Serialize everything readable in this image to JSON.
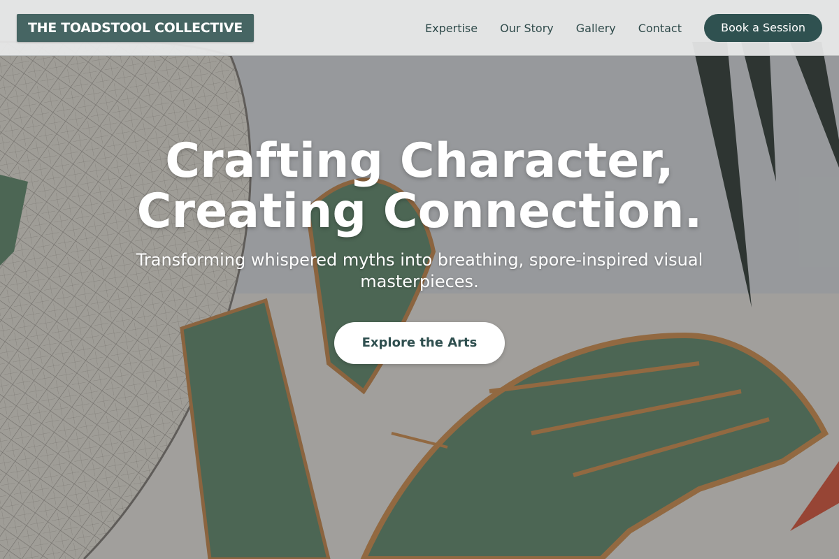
{
  "header": {
    "logo_text": "THE TOADSTOOL COLLECTIVE",
    "nav": [
      {
        "label": "Expertise"
      },
      {
        "label": "Our Story"
      },
      {
        "label": "Gallery"
      },
      {
        "label": "Contact"
      }
    ],
    "cta_label": "Book a Session"
  },
  "hero": {
    "title": "Crafting Character, Creating Connection.",
    "subtitle": "Transforming whispered myths into breathing, spore-inspired visual masterpieces.",
    "button_label": "Explore the Arts",
    "background_image": "illustration-background"
  },
  "colors": {
    "brand": "#466563",
    "cta": "#2f5150",
    "header_bg": "#e8eaea",
    "text_dark": "#2f4a4a",
    "button_text": "#2f4f4f"
  }
}
